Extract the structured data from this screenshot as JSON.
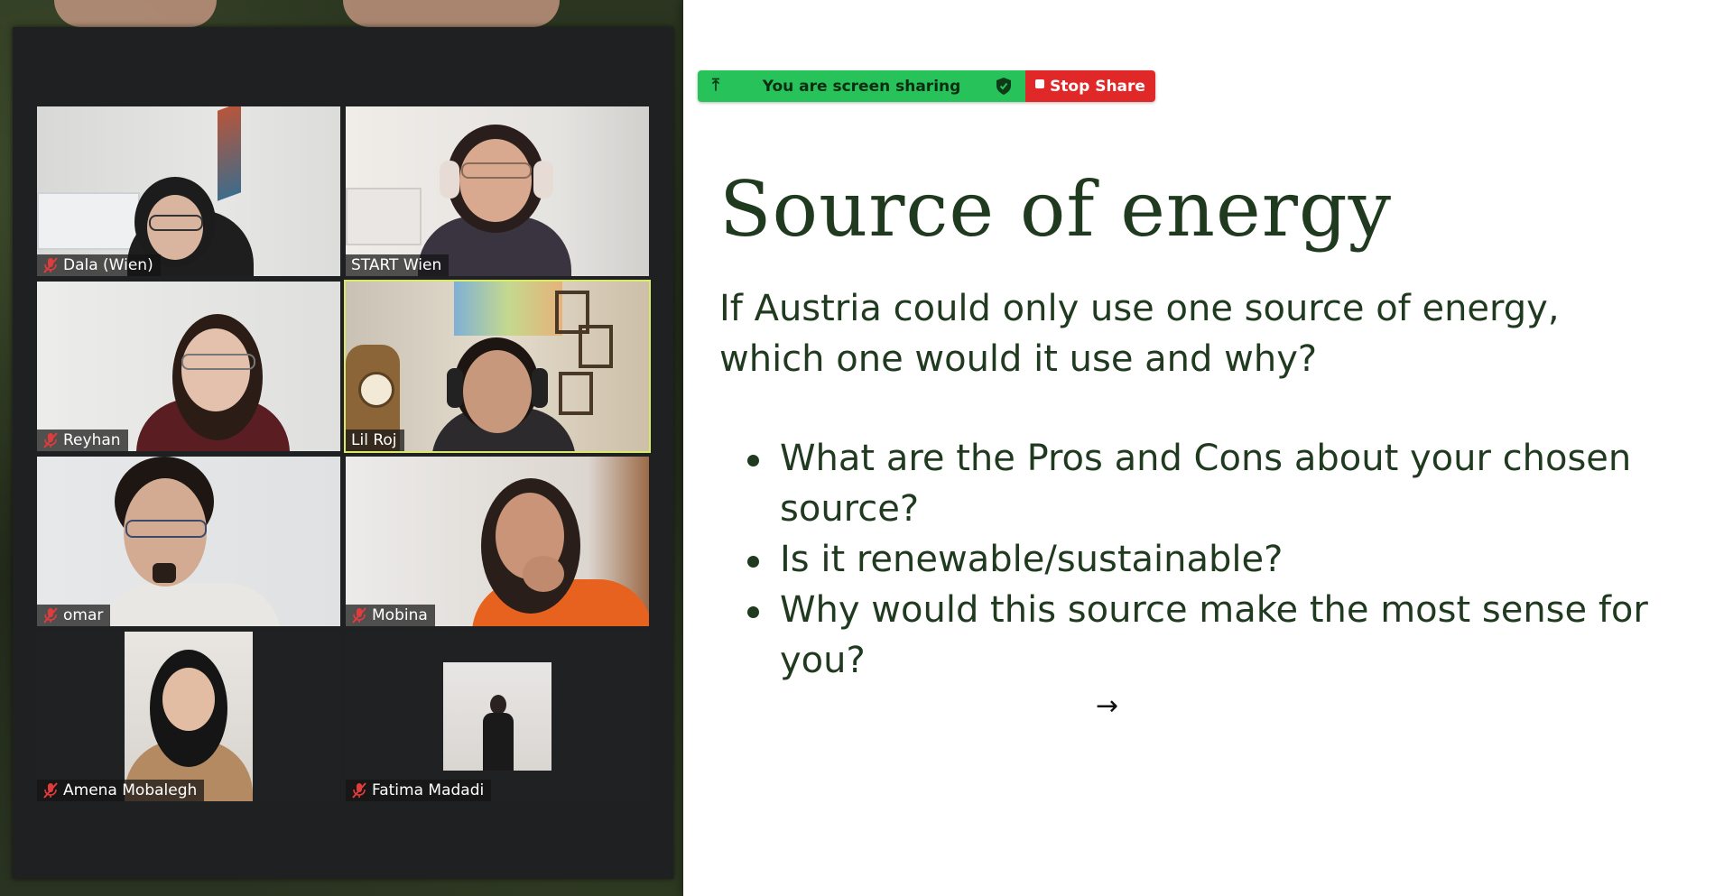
{
  "share_bar": {
    "status_text": "You are screen sharing",
    "stop_label": "Stop Share",
    "icons": {
      "pin": "pin-icon",
      "shield": "shield-check-icon",
      "stop": "stop-square-icon"
    },
    "colors": {
      "sharing_green": "#27c25a",
      "stop_red": "#e02828"
    }
  },
  "gallery": {
    "participants": [
      {
        "name": "Dala (Wien)",
        "muted": true,
        "speaking": false
      },
      {
        "name": "START Wien",
        "muted": false,
        "speaking": false
      },
      {
        "name": "Reyhan",
        "muted": true,
        "speaking": false
      },
      {
        "name": "Lil Roj",
        "muted": false,
        "speaking": true
      },
      {
        "name": "omar",
        "muted": true,
        "speaking": false
      },
      {
        "name": "Mobina",
        "muted": true,
        "speaking": false
      },
      {
        "name": "Amena Mobalegh",
        "muted": true,
        "speaking": false
      },
      {
        "name": "Fatima Madadi",
        "muted": true,
        "speaking": false
      }
    ],
    "colors": {
      "active_speaker_outline": "#d9e86a",
      "muted_icon": "#e23b3b"
    }
  },
  "slide": {
    "title": "Source of energy",
    "question_lines": [
      "If Austria could only use one source of energy,",
      "which one would it use and why?"
    ],
    "bullets": [
      {
        "lines": [
          "What are the Pros and Cons about your chosen",
          "source?"
        ]
      },
      {
        "lines": [
          "Is it renewable/sustainable?"
        ]
      },
      {
        "lines": [
          "Why would this source make the most sense for",
          "you?"
        ]
      }
    ],
    "cursor_glyph": "→",
    "colors": {
      "text": "#1f3a1f"
    }
  }
}
